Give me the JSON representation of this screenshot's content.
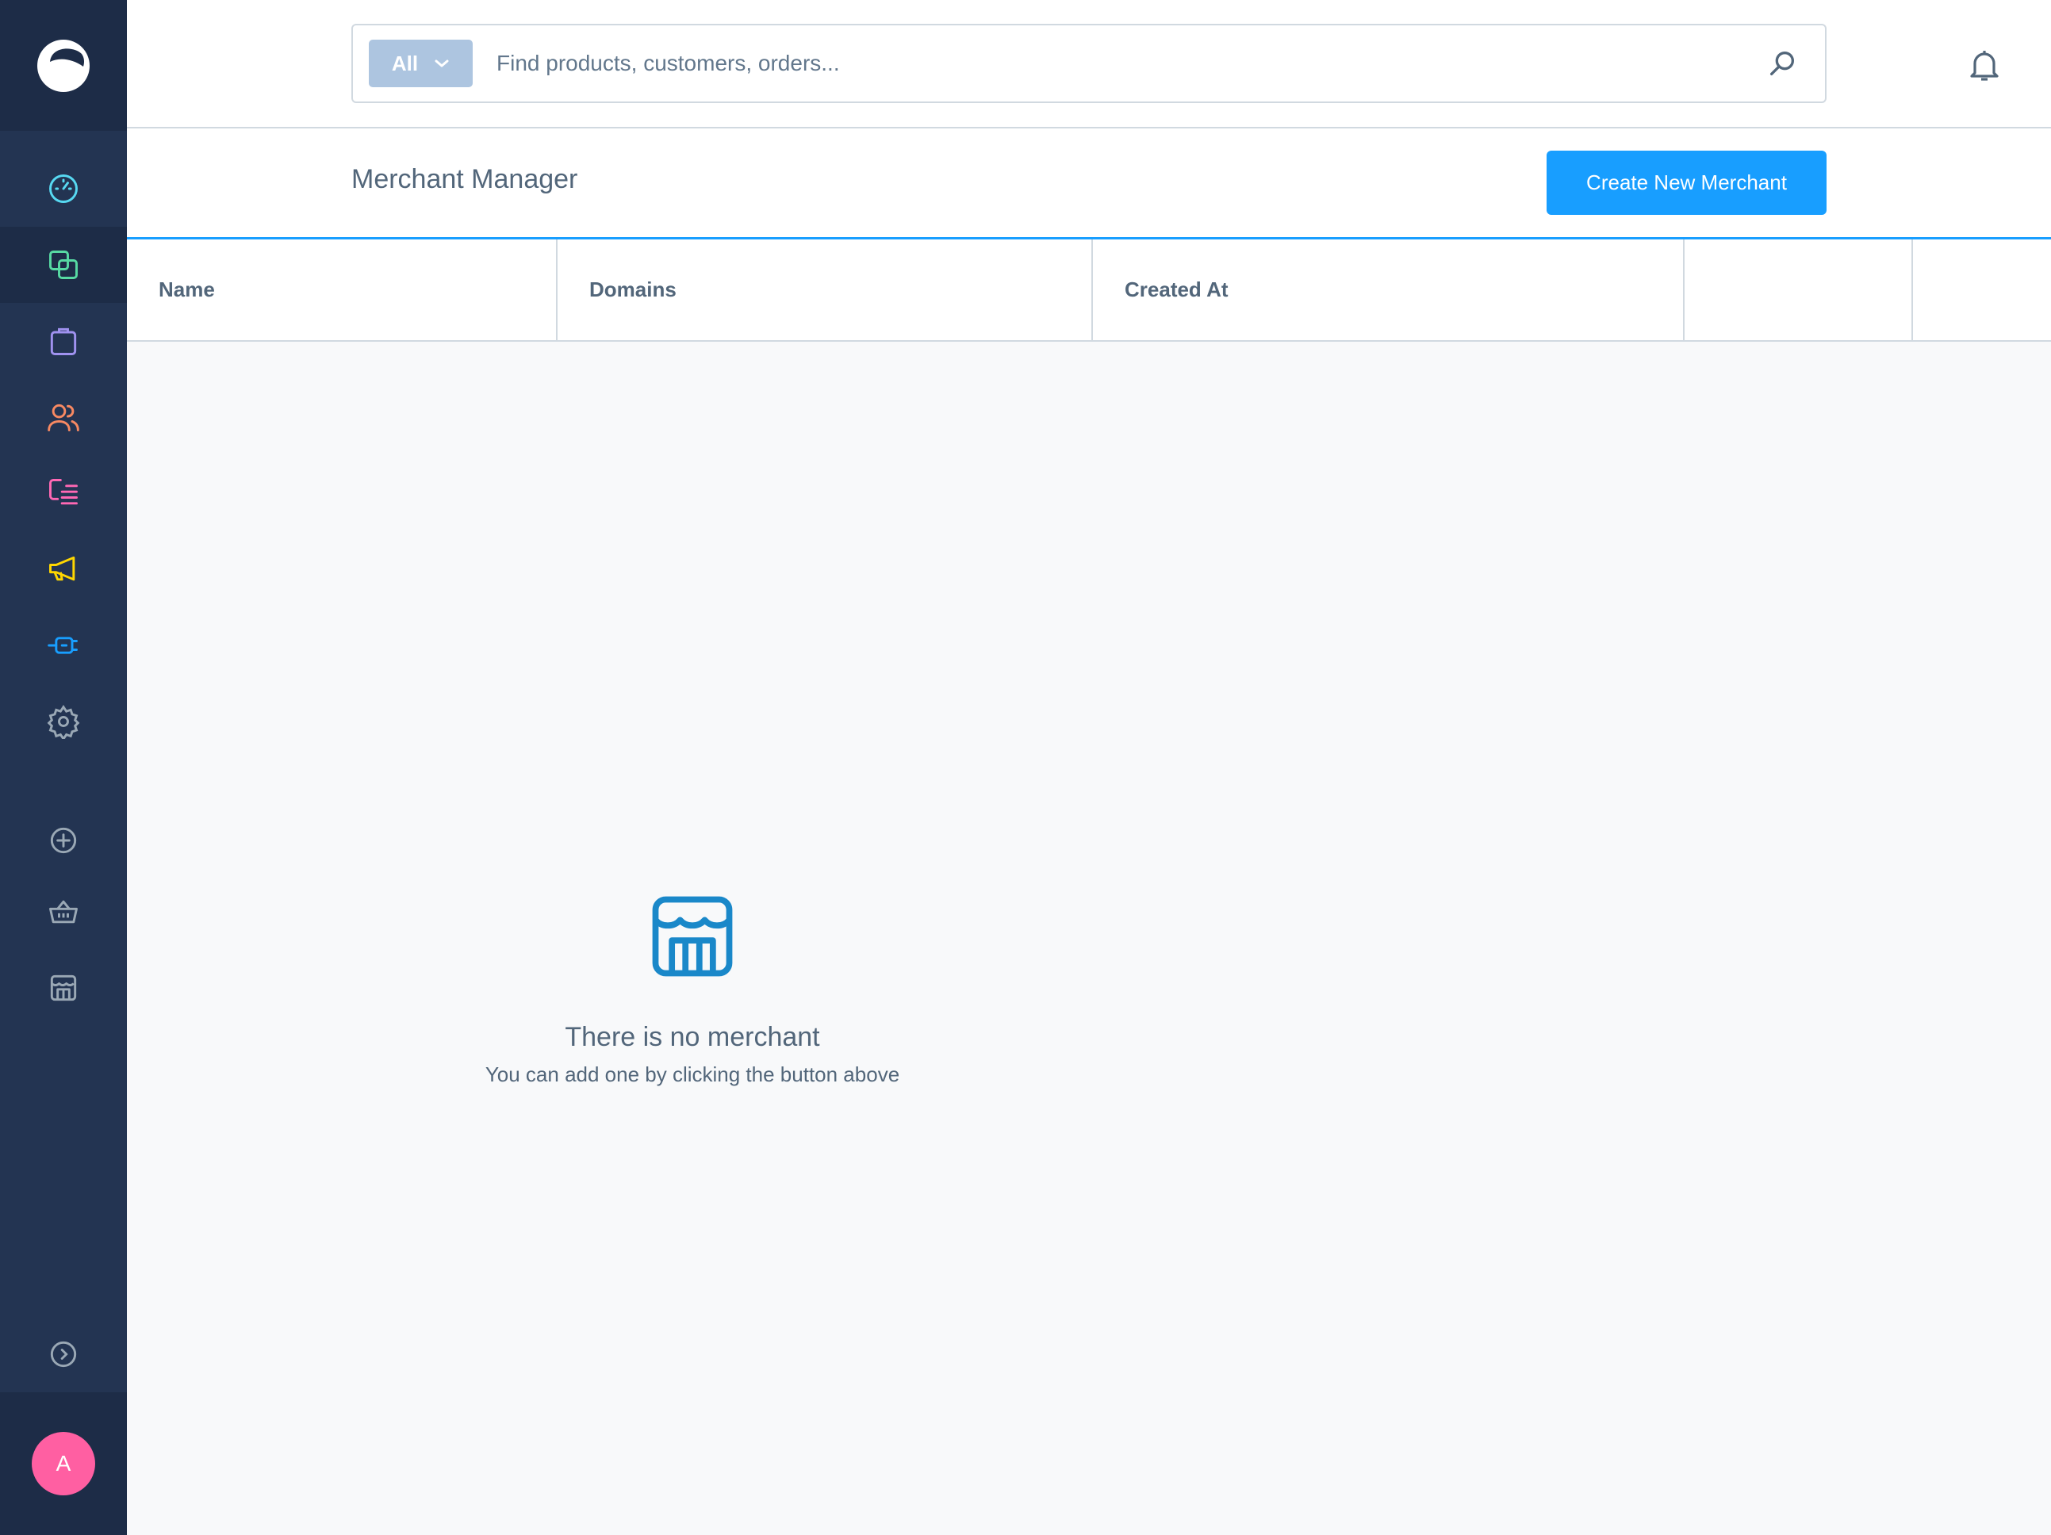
{
  "sidebar": {
    "items": [
      {
        "name": "dashboard",
        "icon": "dashboard-gauge-icon",
        "color": "#57d9f2"
      },
      {
        "name": "catalogues",
        "icon": "catalogue-icon",
        "color": "#57d9a3",
        "active": true
      },
      {
        "name": "orders",
        "icon": "shopping-bag-icon",
        "color": "#a092f0"
      },
      {
        "name": "customers",
        "icon": "customers-icon",
        "color": "#f88962"
      },
      {
        "name": "content",
        "icon": "content-icon",
        "color": "#ff68b4"
      },
      {
        "name": "marketing",
        "icon": "megaphone-icon",
        "color": "#ffd700"
      },
      {
        "name": "extensions",
        "icon": "plug-icon",
        "color": "#189eff"
      },
      {
        "name": "settings",
        "icon": "gear-icon",
        "color": "#9aa8b5"
      },
      {
        "name": "add-sales-channel",
        "icon": "plus-circle-icon",
        "color": "#9aa8b5"
      },
      {
        "name": "storefront",
        "icon": "basket-icon",
        "color": "#9aa8b5"
      },
      {
        "name": "merchant",
        "icon": "store-icon",
        "color": "#9aa8b5"
      },
      {
        "name": "collapse",
        "icon": "chevron-right-circle-icon",
        "color": "#9aa8b5"
      }
    ],
    "avatar_initial": "A"
  },
  "search": {
    "type_label": "All",
    "placeholder": "Find products, customers, orders..."
  },
  "page": {
    "title": "Merchant Manager",
    "create_button": "Create New Merchant"
  },
  "grid": {
    "columns": [
      "Name",
      "Domains",
      "Created At",
      "",
      ""
    ]
  },
  "empty_state": {
    "title": "There is no merchant",
    "subtitle": "You can add one by clicking the button above"
  },
  "colors": {
    "sidebar": "#233452",
    "accent": "#189eff",
    "text": "#52667a"
  }
}
